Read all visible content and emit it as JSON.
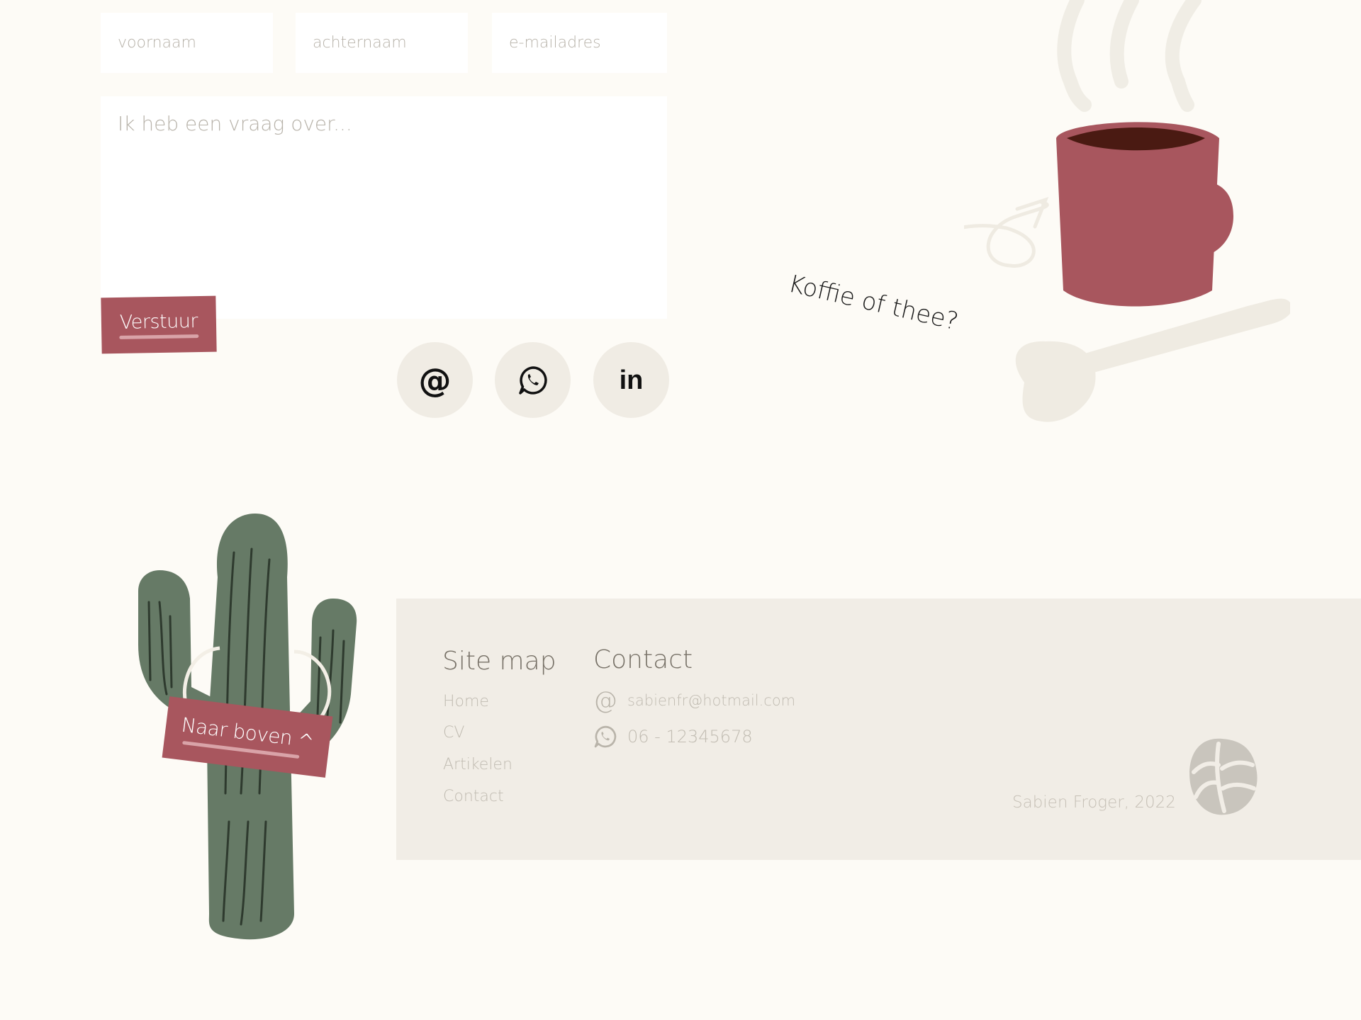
{
  "form": {
    "first_name_placeholder": "voornaam",
    "last_name_placeholder": "achternaam",
    "email_placeholder": "e-mailadres",
    "message_placeholder": "Ik heb een vraag over...",
    "submit_label": "Verstuur"
  },
  "social": [
    {
      "icon": "at-icon",
      "label": "@"
    },
    {
      "icon": "whatsapp-icon"
    },
    {
      "icon": "linkedin-icon",
      "label": "in"
    }
  ],
  "illustration": {
    "caption": "Koffie of thee?"
  },
  "back_to_top": {
    "label": "Naar boven",
    "chevron": "^"
  },
  "footer": {
    "sitemap_title": "Site map",
    "sitemap_links": [
      "Home",
      "CV",
      "Artikelen",
      "Contact"
    ],
    "contact_title": "Contact",
    "email_icon": "@",
    "email": "sabienfr@hotmail.com",
    "phone": "06 - 12345678",
    "copyright": "Sabien Froger, 2022"
  },
  "colors": {
    "background": "#fdfbf6",
    "accent": "#a8565e",
    "footer_bg": "#f1ede6",
    "cactus": "#667a66",
    "social_circle": "#f0ece4"
  }
}
